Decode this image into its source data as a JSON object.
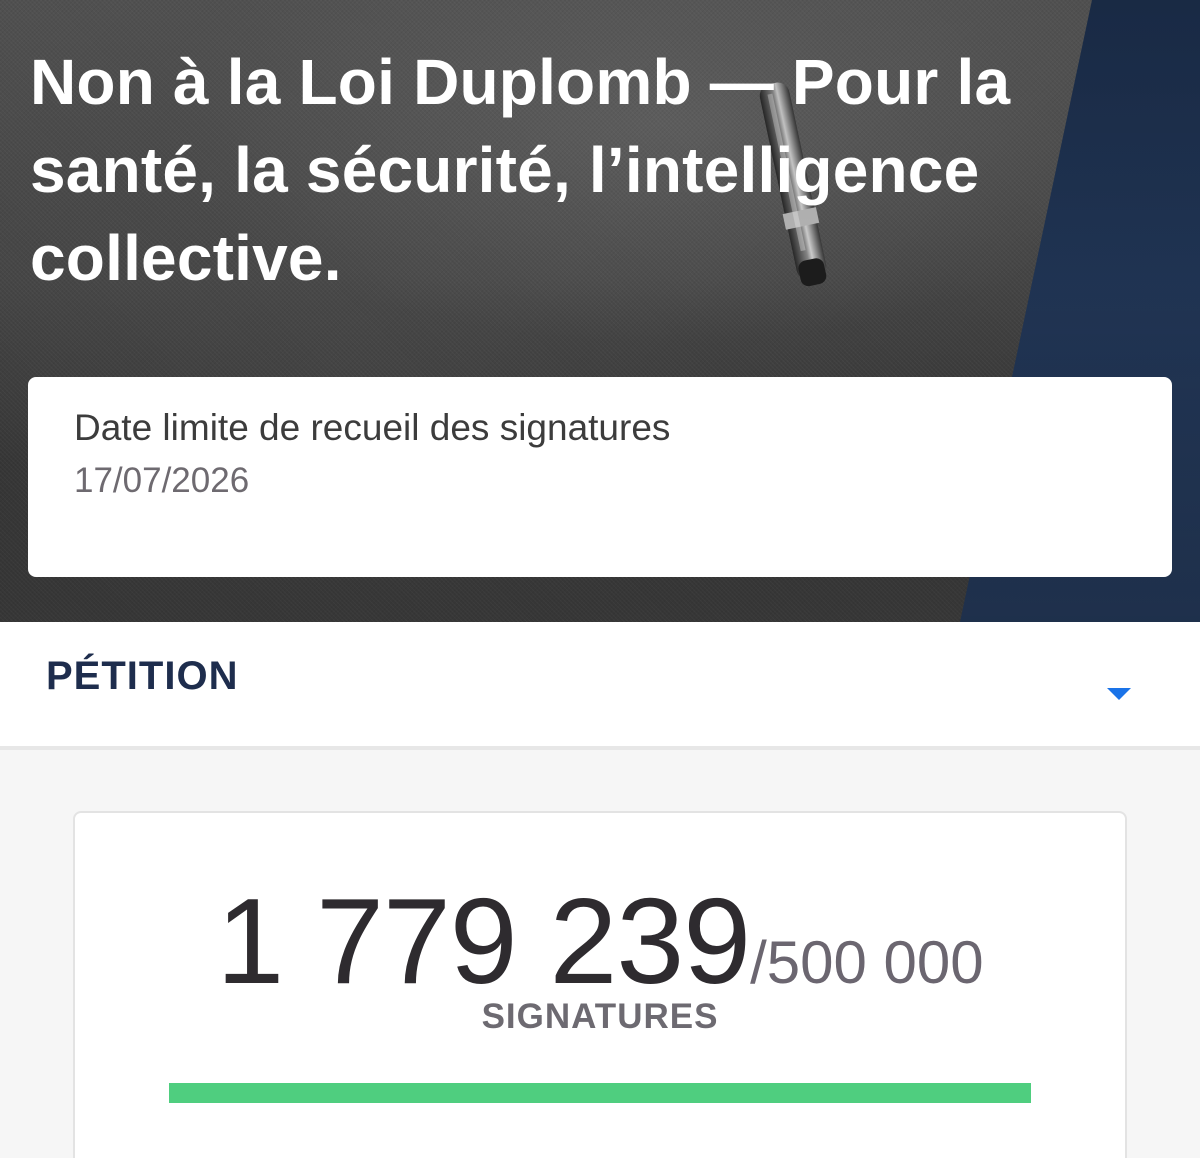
{
  "petition": {
    "title": "Non à la Loi Duplomb — Pour la santé, la sécurité, l’intelligence collective.",
    "deadline_label": "Date limite de recueil des signatures",
    "deadline_value": "17/07/2026"
  },
  "section": {
    "title": "PÉTITION",
    "toggle_icon": "caret-down-icon"
  },
  "signatures": {
    "count": "1 779 239",
    "goal": "/500 000",
    "unit": "SIGNATURES",
    "progress_fraction": 1.0
  },
  "colors": {
    "accent_blue": "#1a73e8",
    "header_navy": "#1e2d4d",
    "progress_green": "#4fce7f",
    "hero_blue_band": "#233a5c"
  }
}
